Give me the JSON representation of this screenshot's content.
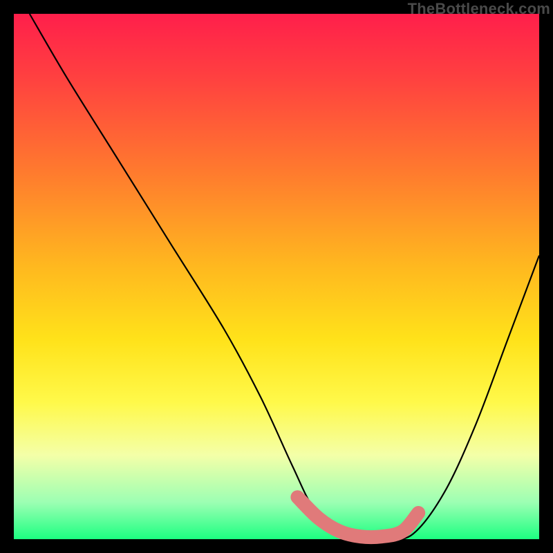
{
  "branding": "TheBottleneck.com",
  "chart_data": {
    "type": "line",
    "title": "",
    "xlabel": "",
    "ylabel": "",
    "xlim": [
      0,
      100
    ],
    "ylim": [
      0,
      100
    ],
    "grid": false,
    "legend": false,
    "series": [
      {
        "name": "bottleneck-curve",
        "color": "#000000",
        "x": [
          3,
          10,
          20,
          30,
          40,
          47,
          53,
          57,
          62,
          67,
          71,
          76,
          82,
          88,
          94,
          100
        ],
        "y": [
          100,
          88,
          72,
          56,
          40,
          27,
          14,
          6,
          1,
          0,
          0,
          1,
          9,
          22,
          38,
          54
        ]
      },
      {
        "name": "sweet-spot-band",
        "color": "#e07a7a",
        "x": [
          54,
          58,
          62,
          66,
          70,
          74,
          77
        ],
        "y": [
          8,
          4,
          1.5,
          0.5,
          0.5,
          1.5,
          5
        ]
      }
    ],
    "colors": {
      "gradient_top": "#ff1f4b",
      "gradient_mid": "#ffe21a",
      "gradient_bottom": "#1cff81",
      "curve": "#000000",
      "band": "#e07a7a",
      "frame": "#000000"
    }
  }
}
